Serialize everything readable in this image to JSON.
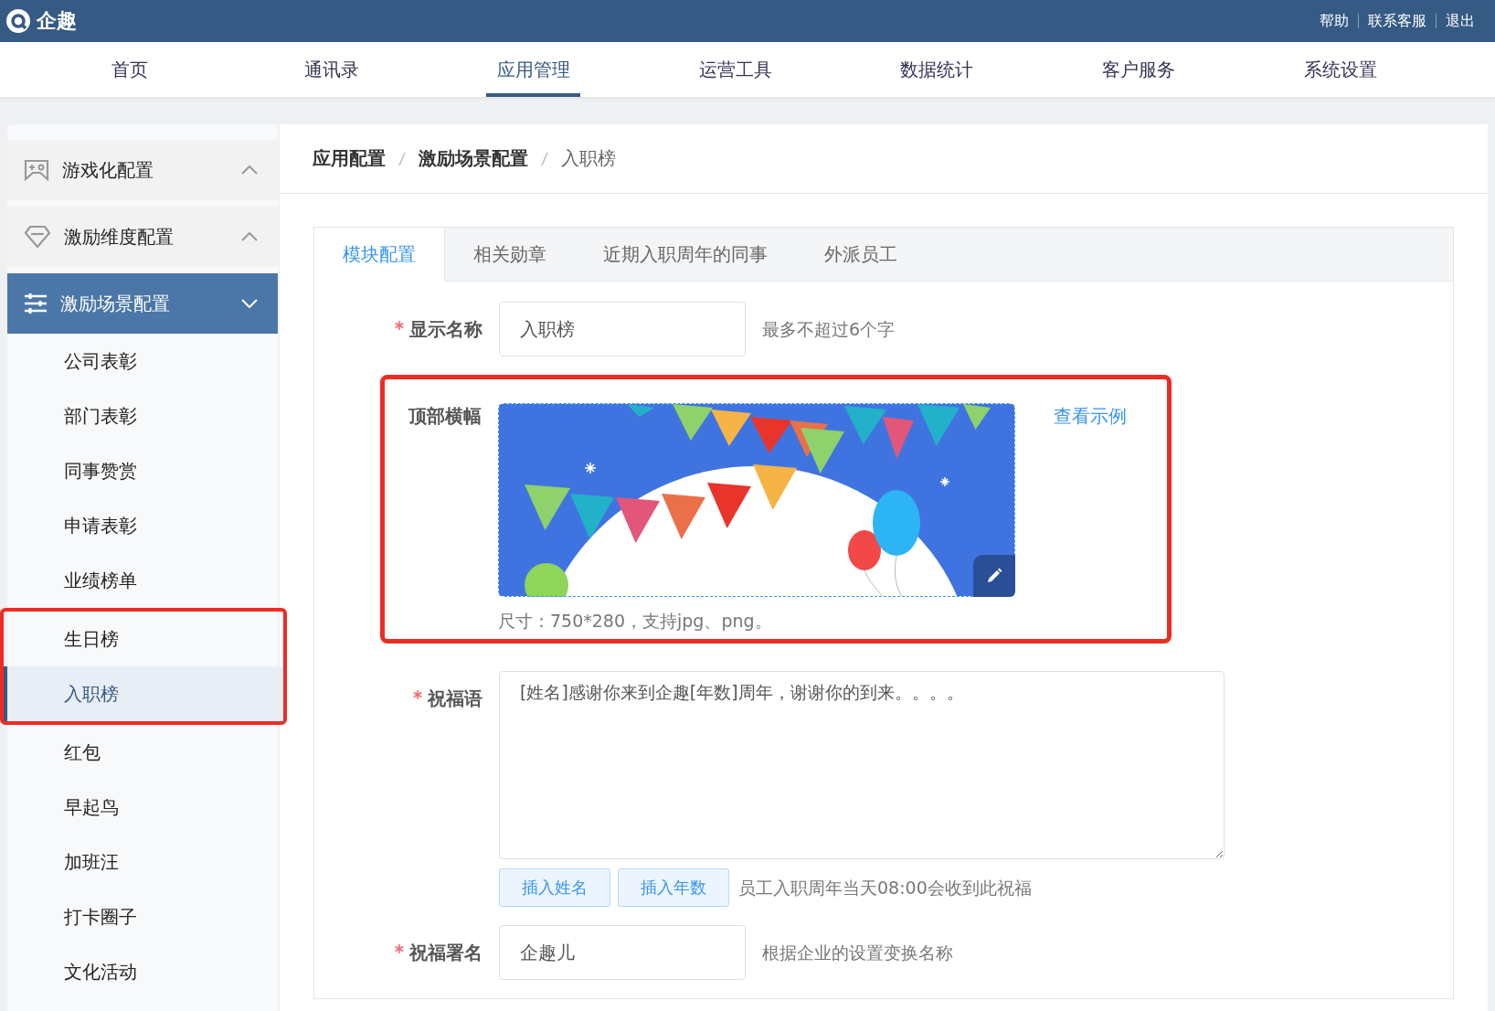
{
  "header": {
    "logo": "企趣",
    "links": [
      "帮助",
      "联系客服",
      "退出"
    ]
  },
  "nav": [
    {
      "label": "首页",
      "selected": false
    },
    {
      "label": "通讯录",
      "selected": false
    },
    {
      "label": "应用管理",
      "selected": true
    },
    {
      "label": "运营工具",
      "selected": false
    },
    {
      "label": "数据统计",
      "selected": false
    },
    {
      "label": "客户服务",
      "selected": false
    },
    {
      "label": "系统设置",
      "selected": false
    }
  ],
  "sidebar": {
    "groups": [
      {
        "label": "游戏化配置",
        "expanded": false,
        "selected": false
      },
      {
        "label": "激励维度配置",
        "expanded": false,
        "selected": false
      },
      {
        "label": "激励场景配置",
        "expanded": true,
        "selected": true,
        "children": [
          {
            "label": "公司表彰",
            "selected": false,
            "highlighted": false
          },
          {
            "label": "部门表彰",
            "selected": false,
            "highlighted": false
          },
          {
            "label": "同事赞赏",
            "selected": false,
            "highlighted": false
          },
          {
            "label": "申请表彰",
            "selected": false,
            "highlighted": false
          },
          {
            "label": "业绩榜单",
            "selected": false,
            "highlighted": false
          },
          {
            "label": "生日榜",
            "selected": false,
            "highlighted": true
          },
          {
            "label": "入职榜",
            "selected": true,
            "highlighted": true
          },
          {
            "label": "红包",
            "selected": false,
            "highlighted": false
          },
          {
            "label": "早起鸟",
            "selected": false,
            "highlighted": false
          },
          {
            "label": "加班汪",
            "selected": false,
            "highlighted": false
          },
          {
            "label": "打卡圈子",
            "selected": false,
            "highlighted": false
          },
          {
            "label": "文化活动",
            "selected": false,
            "highlighted": false
          }
        ]
      }
    ]
  },
  "breadcrumb": [
    "应用配置",
    "激励场景配置",
    "入职榜"
  ],
  "tabs": [
    {
      "label": "模块配置",
      "selected": true
    },
    {
      "label": "相关勋章",
      "selected": false
    },
    {
      "label": "近期入职周年的同事",
      "selected": false
    },
    {
      "label": "外派员工",
      "selected": false
    }
  ],
  "form": [
    {
      "kind": "input",
      "label": "显示名称",
      "required": true,
      "value": "入职榜",
      "hint": "最多不超过6个字"
    },
    {
      "kind": "banner",
      "label": "顶部横幅",
      "highlighted": true,
      "link": "查看示例",
      "hint": "尺寸：750*280，支持jpg、png。"
    },
    {
      "kind": "textarea",
      "label": "祝福语",
      "required": true,
      "value": "[姓名]感谢你来到企趣[年数]周年，谢谢你的到来。。。。",
      "buttons": [
        "插入姓名",
        "插入年数"
      ],
      "hint": "员工入职周年当天08:00会收到此祝福"
    },
    {
      "kind": "input",
      "label": "祝福署名",
      "required": true,
      "value": "企趣儿",
      "hint": "根据企业的设置变换名称"
    }
  ]
}
